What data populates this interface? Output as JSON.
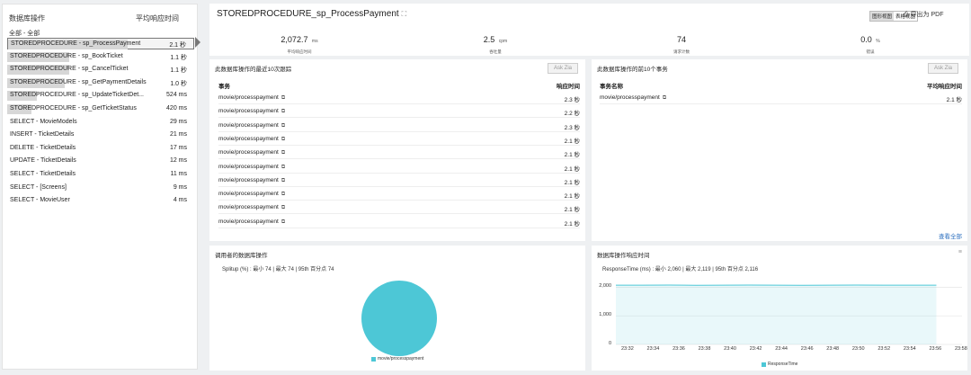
{
  "left": {
    "col_op": "数据库操作",
    "col_time": "平均响应时间",
    "all_label": "全部 - 全部",
    "rows": [
      {
        "name": "STOREDPROCEDURE - sp_ProcessPayment",
        "time": "2.1 秒",
        "bar": 1.0
      },
      {
        "name": "STOREDPROCEDURE - sp_BookTicket",
        "time": "1.1 秒",
        "bar": 0.52
      },
      {
        "name": "STOREDPROCEDURE - sp_CancelTicket",
        "time": "1.1 秒",
        "bar": 0.52
      },
      {
        "name": "STOREDPROCEDURE - sp_GetPaymentDetails",
        "time": "1.0 秒",
        "bar": 0.48
      },
      {
        "name": "STOREDPROCEDURE - sp_UpdateTicketDet...",
        "time": "524 ms",
        "bar": 0.25
      },
      {
        "name": "STOREDPROCEDURE - sp_GetTicketStatus",
        "time": "420 ms",
        "bar": 0.2
      },
      {
        "name": "SELECT - MovieModels",
        "time": "29 ms",
        "bar": 0
      },
      {
        "name": "INSERT - TicketDetails",
        "time": "21 ms",
        "bar": 0
      },
      {
        "name": "DELETE - TicketDetails",
        "time": "17 ms",
        "bar": 0
      },
      {
        "name": "UPDATE - TicketDetails",
        "time": "12 ms",
        "bar": 0
      },
      {
        "name": "SELECT - TicketDetails",
        "time": "11 ms",
        "bar": 0
      },
      {
        "name": "SELECT - [Screens]",
        "time": "9 ms",
        "bar": 0
      },
      {
        "name": "SELECT - MovieUser",
        "time": "4 ms",
        "bar": 0
      }
    ]
  },
  "header": {
    "title": "STOREDPROCEDURE_sp_ProcessPayment",
    "expand_icon": "expand-icon",
    "btn_chart": "图形视图",
    "btn_table": "表格视图",
    "pdf": "导出为 PDF",
    "stats": [
      {
        "value": "2,072.7",
        "unit": "ms",
        "label": "平均响应时间"
      },
      {
        "value": "2.5",
        "unit": "cpm",
        "label": "吞吐量"
      },
      {
        "value": "74",
        "unit": "",
        "label": "请求计数"
      },
      {
        "value": "0.0",
        "unit": "%",
        "label": "错误"
      }
    ]
  },
  "traces": {
    "title": "此数据库操作的最近10次跟踪",
    "ask": "Ask Zia",
    "col_tx": "事务",
    "col_time": "响应时间",
    "rows": [
      {
        "name": "movie/processpayment",
        "time": "2.3 秒"
      },
      {
        "name": "movie/processpayment",
        "time": "2.2 秒"
      },
      {
        "name": "movie/processpayment",
        "time": "2.3 秒"
      },
      {
        "name": "movie/processpayment",
        "time": "2.1 秒"
      },
      {
        "name": "movie/processpayment",
        "time": "2.1 秒"
      },
      {
        "name": "movie/processpayment",
        "time": "2.1 秒"
      },
      {
        "name": "movie/processpayment",
        "time": "2.1 秒"
      },
      {
        "name": "movie/processpayment",
        "time": "2.1 秒"
      },
      {
        "name": "movie/processpayment",
        "time": "2.1 秒"
      },
      {
        "name": "movie/processpayment",
        "time": "2.1 秒"
      }
    ]
  },
  "top_tx": {
    "title": "此数据库操作的前10个事务",
    "ask": "Ask Zia",
    "col_tx": "事务名称",
    "col_time": "平均响应时间",
    "rows": [
      {
        "name": "movie/processpayment",
        "time": "2.1 秒"
      }
    ],
    "view_all": "查看全部"
  },
  "pie": {
    "title": "调用者的数据库操作",
    "subtitle": "Splitup (%) :  最小 74  |  最大 74  |  95th 百分点 74",
    "legend": "movie/processpayment",
    "color": "#4dc7d6"
  },
  "resp_chart": {
    "title": "数据库操作响应时间",
    "subtitle": "ResponseTime (ms) :  最小 2,060  |  最大 2,119  |  95th 百分点 2,116",
    "legend": "ResponseTime",
    "color": "#4dc7d6"
  },
  "chart_data": [
    {
      "type": "pie",
      "title": "调用者的数据库操作",
      "slices": [
        {
          "name": "movie/processpayment",
          "value": 100
        }
      ]
    },
    {
      "type": "area",
      "title": "数据库操作响应时间",
      "categories": [
        "23:32",
        "23:34",
        "23:36",
        "23:38",
        "23:40",
        "23:42",
        "23:44",
        "23:46",
        "23:48",
        "23:50",
        "23:52",
        "23:54",
        "23:56",
        "23:58"
      ],
      "series": [
        {
          "name": "ResponseTime",
          "values": [
            2072,
            2070,
            2075,
            2068,
            2072,
            2074,
            2070,
            2066,
            2072,
            2073,
            2071,
            2069,
            2072
          ]
        }
      ],
      "yticks": [
        "0",
        "1,000",
        "2,000"
      ],
      "ylim": [
        0,
        2200
      ]
    }
  ]
}
